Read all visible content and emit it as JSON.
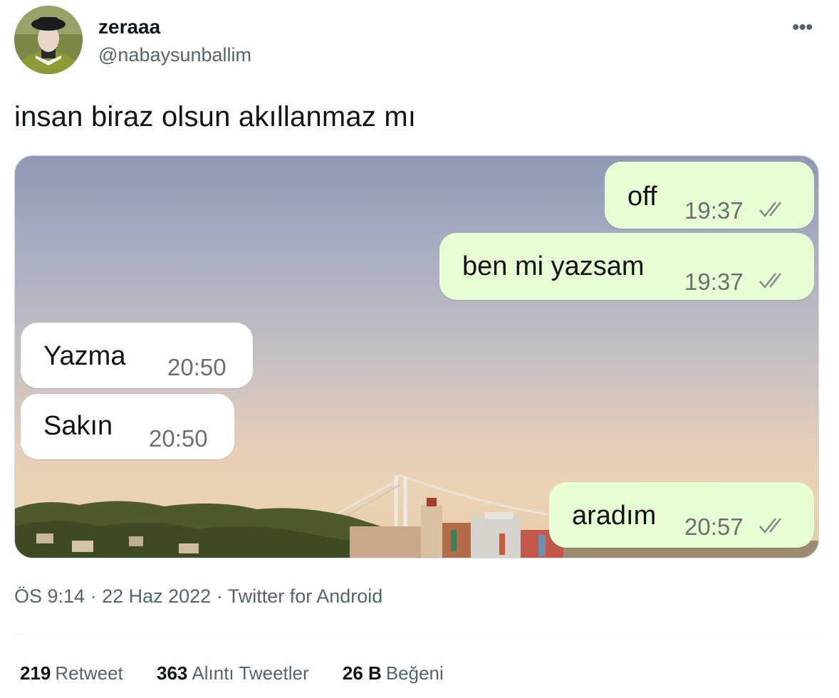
{
  "tweet": {
    "display_name": "zeraaa",
    "handle": "@nabaysunballim",
    "text": "insan biraz olsun akıllanmaz mı",
    "more_icon": "more-icon"
  },
  "chat": {
    "messages": [
      {
        "text": "off",
        "time": "19:37",
        "direction": "outgoing",
        "status_icon": "double-check-icon"
      },
      {
        "text": "ben mi yazsam",
        "time": "19:37",
        "direction": "outgoing",
        "status_icon": "double-check-icon"
      },
      {
        "text": "Yazma",
        "time": "20:50",
        "direction": "incoming"
      },
      {
        "text": "Sakın",
        "time": "20:50",
        "direction": "incoming"
      },
      {
        "text": "aradım",
        "time": "20:57",
        "direction": "outgoing",
        "status_icon": "double-check-icon"
      }
    ],
    "colors": {
      "outgoing_bubble": "#e7fed5",
      "incoming_bubble": "#ffffff"
    }
  },
  "meta": {
    "time": "ÖS 9:14",
    "sep1": " · ",
    "date": "22 Haz 2022",
    "sep2": " · ",
    "source": "Twitter for Android"
  },
  "stats": {
    "retweets_count": "219",
    "retweets_label": "Retweet",
    "quotes_count": "363",
    "quotes_label": "Alıntı Tweetler",
    "likes_count": "26 B",
    "likes_label": "Beğeni"
  }
}
